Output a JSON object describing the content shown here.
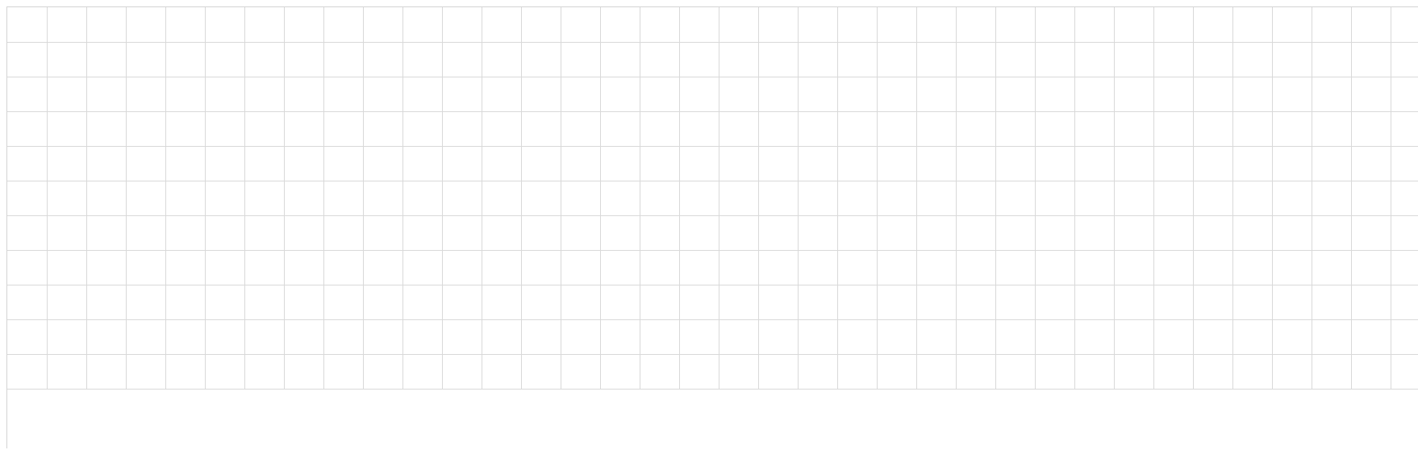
{
  "sheet": {
    "rows": 11,
    "columns": 36,
    "cells": []
  },
  "colors": {
    "background": "#ffffff",
    "gridline": "#d9d9d9",
    "outer_border": "#d4d4d4"
  }
}
